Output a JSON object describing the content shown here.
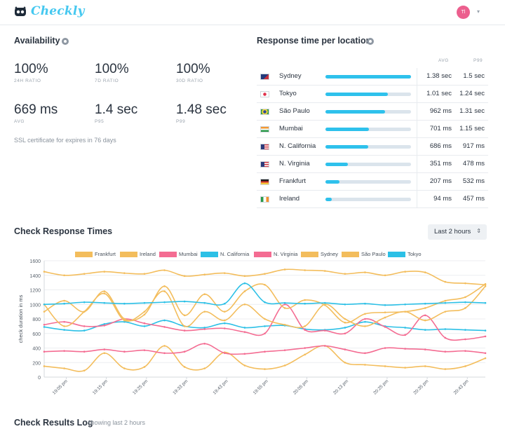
{
  "app": {
    "name": "Checkly",
    "avatar_initials": "Tl"
  },
  "availability": {
    "title": "Availability",
    "stats": [
      {
        "value": "100%",
        "label": "24H RATIO"
      },
      {
        "value": "100%",
        "label": "7D RATIO"
      },
      {
        "value": "100%",
        "label": "30D RATIO"
      },
      {
        "value": "669 ms",
        "label": "AVG"
      },
      {
        "value": "1.4 sec",
        "label": "P95"
      },
      {
        "value": "1.48 sec",
        "label": "P99"
      }
    ],
    "ssl_note": "SSL certificate for expires in 76 days"
  },
  "locations": {
    "title": "Response time per location",
    "col_avg": "AVG",
    "col_p99": "P99",
    "rows": [
      {
        "name": "Sydney",
        "avg": "1.38 sec",
        "p99": "1.5 sec",
        "fill": 1.0,
        "flag": "australia-flag-icon"
      },
      {
        "name": "Tokyo",
        "avg": "1.01 sec",
        "p99": "1.24 sec",
        "fill": 0.73,
        "flag": "japan-flag-icon"
      },
      {
        "name": "São Paulo",
        "avg": "962 ms",
        "p99": "1.31 sec",
        "fill": 0.7,
        "flag": "brazil-flag-icon"
      },
      {
        "name": "Mumbai",
        "avg": "701 ms",
        "p99": "1.15 sec",
        "fill": 0.51,
        "flag": "india-flag-icon"
      },
      {
        "name": "N. California",
        "avg": "686 ms",
        "p99": "917 ms",
        "fill": 0.5,
        "flag": "usa-flag-icon"
      },
      {
        "name": "N. Virginia",
        "avg": "351 ms",
        "p99": "478 ms",
        "fill": 0.26,
        "flag": "usa-flag-icon"
      },
      {
        "name": "Frankfurt",
        "avg": "207 ms",
        "p99": "532 ms",
        "fill": 0.16,
        "flag": "germany-flag-icon"
      },
      {
        "name": "Ireland",
        "avg": "94 ms",
        "p99": "457 ms",
        "fill": 0.07,
        "flag": "ireland-flag-icon"
      }
    ]
  },
  "response_times": {
    "title": "Check Response Times",
    "range_label": "Last 2 hours"
  },
  "results_log": {
    "title": "Check Results Log",
    "subtitle": "showing last 2 hours"
  },
  "chart_data": {
    "type": "line",
    "ylabel": "check duration in ms",
    "ylim": [
      0,
      1600
    ],
    "yticks": [
      0,
      200,
      400,
      600,
      800,
      1000,
      1200,
      1400,
      1600
    ],
    "xlim": [
      0,
      110
    ],
    "xticks": [
      "19:05 pm",
      "19:15 pm",
      "19:25 pm",
      "19:33 pm",
      "19:43 pm",
      "19:55 pm",
      "20:05 pm",
      "20:13 pm",
      "20:25 pm",
      "20:35 pm",
      "20:43 pm"
    ],
    "x": [
      0,
      5,
      10,
      15,
      20,
      25,
      30,
      35,
      40,
      45,
      50,
      55,
      60,
      65,
      70,
      75,
      80,
      85,
      90,
      95,
      100,
      105,
      110
    ],
    "series": [
      {
        "name": "Frankfurt",
        "color": "#f3bd5c",
        "values": [
          1450,
          1400,
          1420,
          1450,
          1430,
          1420,
          1470,
          1390,
          1410,
          1430,
          1390,
          1420,
          1480,
          1470,
          1460,
          1420,
          1440,
          1400,
          1450,
          1440,
          1310,
          1290,
          1270
        ]
      },
      {
        "name": "Ireland",
        "color": "#f3bd5c",
        "values": [
          150,
          120,
          90,
          330,
          120,
          140,
          430,
          140,
          120,
          340,
          160,
          110,
          160,
          310,
          430,
          200,
          170,
          150,
          130,
          150,
          110,
          150,
          260
        ]
      },
      {
        "name": "Mumbai",
        "color": "#f46c92",
        "values": [
          350,
          360,
          350,
          380,
          350,
          370,
          330,
          350,
          460,
          330,
          320,
          350,
          370,
          400,
          430,
          380,
          330,
          400,
          390,
          380,
          350,
          360,
          330
        ]
      },
      {
        "name": "N. California",
        "color": "#2cc0e6",
        "values": [
          690,
          650,
          640,
          730,
          760,
          700,
          780,
          700,
          680,
          740,
          680,
          700,
          710,
          660,
          650,
          680,
          760,
          700,
          680,
          650,
          660,
          650,
          640
        ]
      },
      {
        "name": "N. Virginia",
        "color": "#f46c92",
        "values": [
          720,
          760,
          700,
          710,
          800,
          740,
          690,
          640,
          660,
          670,
          620,
          600,
          1000,
          650,
          640,
          600,
          800,
          690,
          580,
          850,
          540,
          520,
          560
        ]
      },
      {
        "name": "Sydney",
        "color": "#f3bd5c",
        "values": [
          900,
          1050,
          900,
          1180,
          800,
          860,
          1250,
          850,
          1140,
          900,
          1180,
          1270,
          950,
          1060,
          990,
          750,
          870,
          890,
          900,
          950,
          1050,
          1100,
          1280
        ]
      },
      {
        "name": "São Paulo",
        "color": "#f3bd5c",
        "values": [
          1000,
          700,
          900,
          1150,
          780,
          900,
          1180,
          700,
          900,
          780,
          1000,
          800,
          720,
          700,
          1000,
          800,
          700,
          820,
          900,
          780,
          900,
          950,
          1250
        ]
      },
      {
        "name": "Tokyo",
        "color": "#2cc0e6",
        "values": [
          1000,
          1010,
          1030,
          1020,
          1010,
          1020,
          1030,
          1040,
          1020,
          1010,
          1290,
          1030,
          1020,
          1010,
          1020,
          1000,
          1010,
          990,
          1000,
          1010,
          1020,
          1030,
          1020
        ]
      }
    ]
  }
}
